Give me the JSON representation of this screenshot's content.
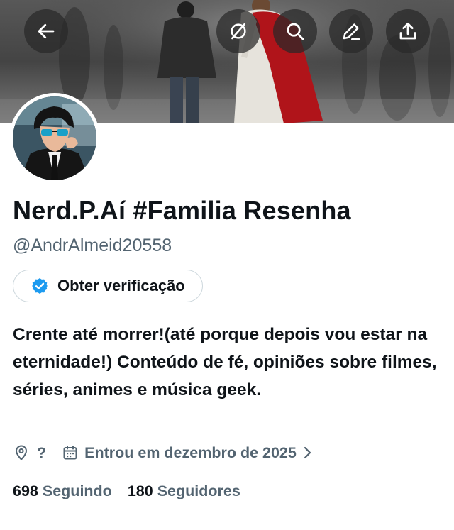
{
  "header": {
    "back_icon": "arrow-left-icon",
    "mute_icon": "mute-icon",
    "search_icon": "search-icon",
    "edit_icon": "edit-pencil-icon",
    "share_icon": "share-upload-icon"
  },
  "profile": {
    "display_name": "Nerd.P.Aí #Familia Resenha",
    "handle": "@AndrAlmeid20558",
    "verify_button_label": "Obter verificação",
    "bio": "Crente até morrer!(até porque depois vou estar na eternidade!) Conteúdo de fé, opiniões sobre filmes, séries, animes e música geek.",
    "location": "?",
    "joined": "Entrou em dezembro de 2025",
    "following_count": "698",
    "following_label": "Seguindo",
    "followers_count": "180",
    "followers_label": "Seguidores"
  },
  "colors": {
    "accent_blue": "#1d9bf0",
    "secondary_text": "#536471",
    "primary_text": "#0f1419",
    "border": "#cfd9de",
    "robe_red": "#b0141a"
  }
}
